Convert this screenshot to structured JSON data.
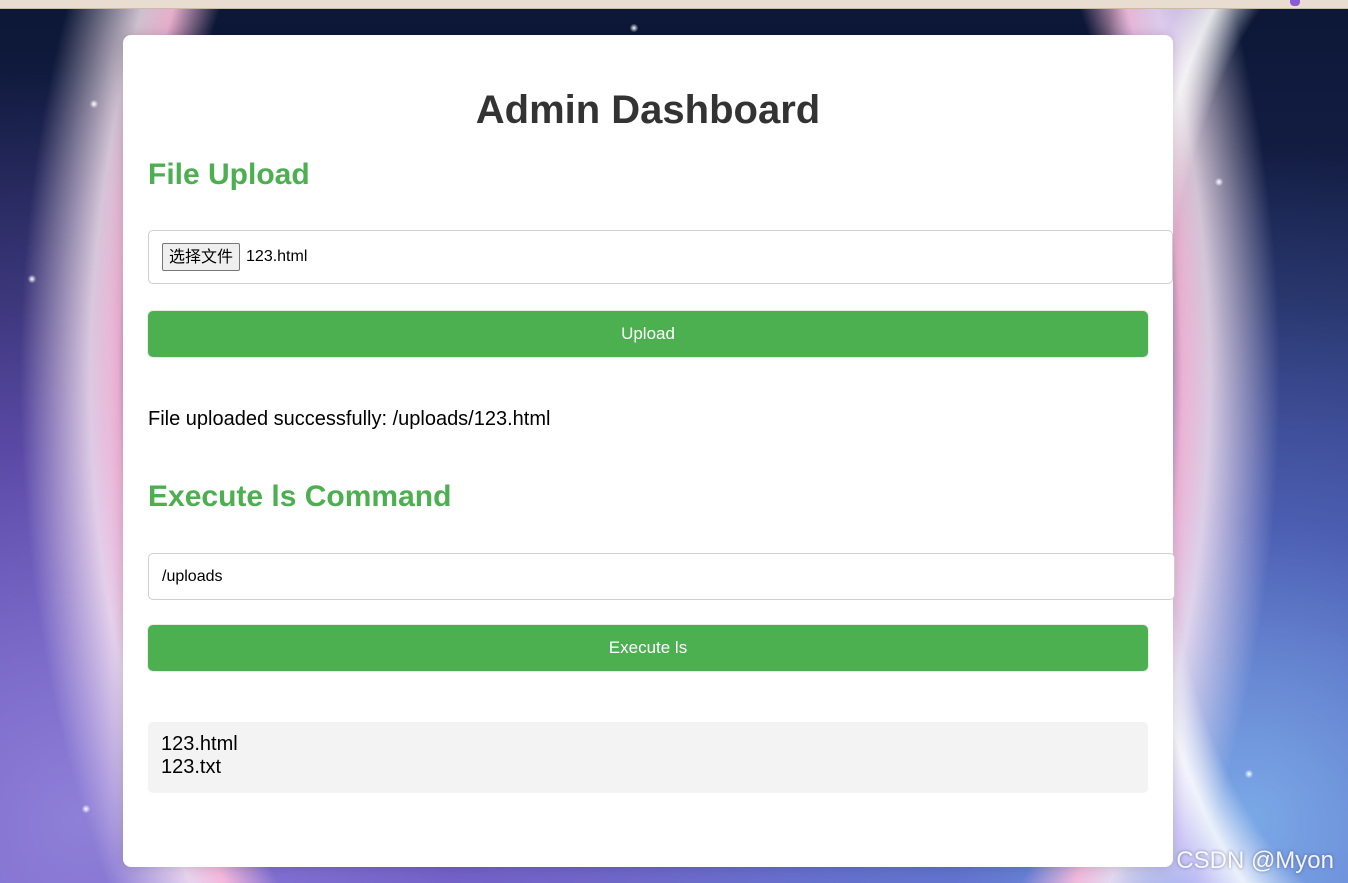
{
  "page": {
    "title": "Admin Dashboard"
  },
  "upload_section": {
    "heading": "File Upload",
    "choose_file_label": "选择文件",
    "selected_file": "123.html",
    "upload_button_label": "Upload",
    "status_message": "File uploaded successfully: /uploads/123.html"
  },
  "exec_section": {
    "heading": "Execute ls Command",
    "directory_value": "/uploads",
    "directory_placeholder": "",
    "execute_button_label": "Execute ls",
    "output_lines": [
      "123.html",
      "123.txt"
    ]
  },
  "watermark": "CSDN @Myon",
  "colors": {
    "accent": "#4caf50",
    "title": "#333333",
    "output_bg": "#f3f3f3"
  }
}
